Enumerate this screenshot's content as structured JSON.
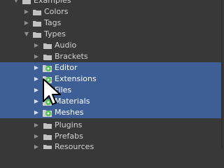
{
  "tree": {
    "items": [
      {
        "label": "Examples",
        "expanded": true,
        "icon": "folder-icon",
        "selected": false
      },
      {
        "label": "Colors",
        "expanded": false,
        "icon": "folder-icon",
        "selected": false
      },
      {
        "label": "Tags",
        "expanded": false,
        "icon": "folder-icon",
        "selected": false
      },
      {
        "label": "Types",
        "expanded": true,
        "icon": "folder-icon",
        "selected": false
      },
      {
        "label": "Audio",
        "expanded": false,
        "icon": "folder-icon",
        "selected": false
      },
      {
        "label": "Brackets",
        "expanded": false,
        "icon": "folder-icon",
        "selected": false
      },
      {
        "label": "Editor",
        "expanded": false,
        "icon": "package-icon",
        "selected": true
      },
      {
        "label": "Extensions",
        "expanded": false,
        "icon": "package-icon",
        "selected": true
      },
      {
        "label": "Files",
        "expanded": false,
        "icon": "package-icon",
        "selected": true
      },
      {
        "label": "Materials",
        "expanded": false,
        "icon": "package-icon",
        "selected": true
      },
      {
        "label": "Meshes",
        "expanded": false,
        "icon": "package-icon",
        "selected": true
      },
      {
        "label": "Plugins",
        "expanded": false,
        "icon": "folder-icon",
        "selected": false
      },
      {
        "label": "Prefabs",
        "expanded": false,
        "icon": "folder-icon",
        "selected": false
      },
      {
        "label": "Resources",
        "expanded": false,
        "icon": "folder-icon",
        "selected": false
      }
    ]
  },
  "colors": {
    "background": "#383838",
    "selection": "#3e5f96",
    "folder": "#c2c2c2",
    "package_green": "#4fc24f"
  }
}
